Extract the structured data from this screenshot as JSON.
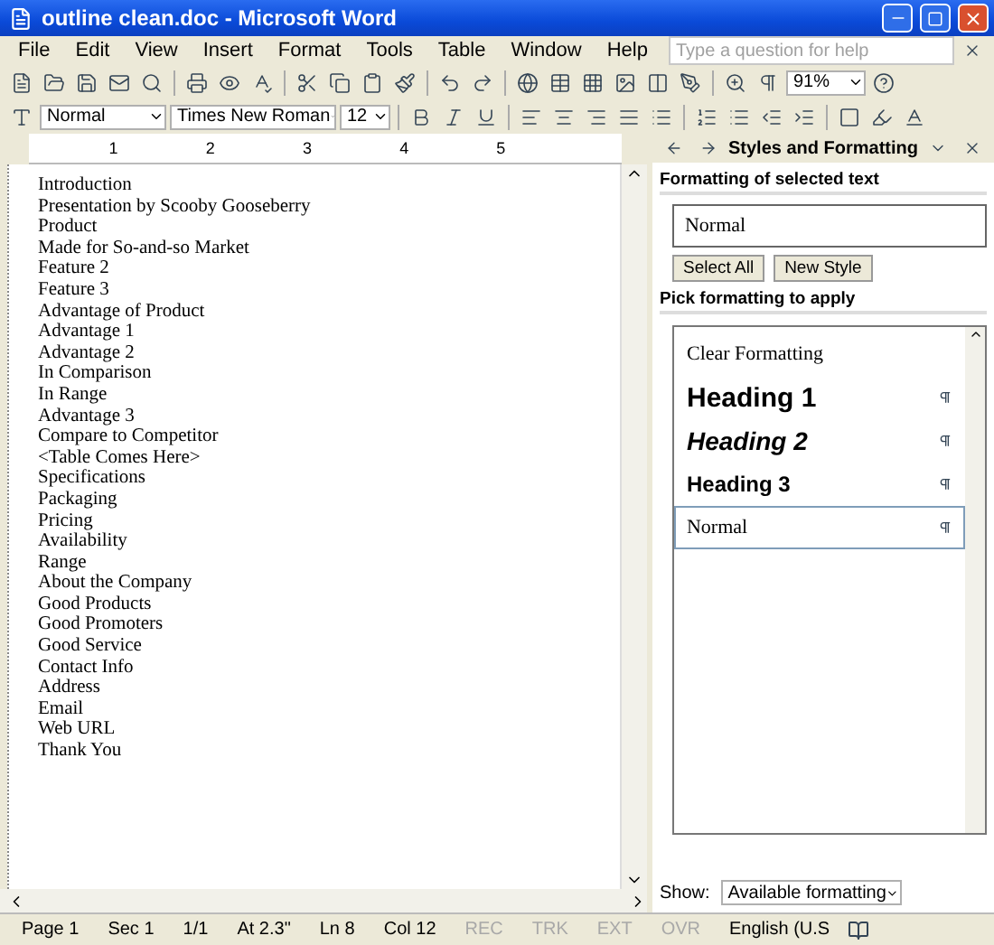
{
  "window": {
    "title": "outline clean.doc - Microsoft Word"
  },
  "menu": [
    "File",
    "Edit",
    "View",
    "Insert",
    "Format",
    "Tools",
    "Table",
    "Window",
    "Help"
  ],
  "help_box": {
    "placeholder": "Type a question for help"
  },
  "toolbar": {
    "zoom": "91%"
  },
  "format_bar": {
    "style": "Normal",
    "font": "Times New Roman",
    "size": "12"
  },
  "ruler": [
    "1",
    "2",
    "3",
    "4",
    "5"
  ],
  "document": {
    "lines": [
      "Introduction",
      "Presentation by Scooby Gooseberry",
      "Product",
      "Made for So-and-so Market",
      "Feature 2",
      "Feature 3",
      "Advantage of Product",
      "Advantage 1",
      "Advantage 2",
      "In Comparison",
      "In Range",
      "Advantage 3",
      "Compare to Competitor",
      "<Table Comes Here>",
      "Specifications",
      "Packaging",
      "Pricing",
      "Availability",
      "Range",
      "About the Company",
      "Good Products",
      "Good Promoters",
      "Good Service",
      "Contact Info",
      "Address",
      "Email",
      "Web URL",
      "Thank You"
    ]
  },
  "task_pane": {
    "title": "Styles and Formatting",
    "selected_heading": "Formatting of selected text",
    "selected_style": "Normal",
    "buttons": [
      "Select All",
      "New Style"
    ],
    "pick_heading": "Pick formatting to apply",
    "styles": [
      {
        "name": "Clear Formatting",
        "kind": "clear",
        "selected": false
      },
      {
        "name": "Heading 1",
        "kind": "h1",
        "selected": false
      },
      {
        "name": "Heading 2",
        "kind": "h2",
        "selected": false
      },
      {
        "name": "Heading 3",
        "kind": "h3",
        "selected": false
      },
      {
        "name": "Normal",
        "kind": "normal",
        "selected": true
      }
    ],
    "show_label": "Show:",
    "show_value": "Available formatting"
  },
  "status_bar": [
    {
      "text": "Page 1",
      "disabled": false
    },
    {
      "text": "Sec 1",
      "disabled": false
    },
    {
      "text": "1/1",
      "disabled": false
    },
    {
      "text": "At 2.3\"",
      "disabled": false
    },
    {
      "text": "Ln 8",
      "disabled": false
    },
    {
      "text": "Col 12",
      "disabled": false
    },
    {
      "text": "REC",
      "disabled": true
    },
    {
      "text": "TRK",
      "disabled": true
    },
    {
      "text": "EXT",
      "disabled": true
    },
    {
      "text": "OVR",
      "disabled": true
    },
    {
      "text": "English (U.S",
      "disabled": false
    }
  ]
}
